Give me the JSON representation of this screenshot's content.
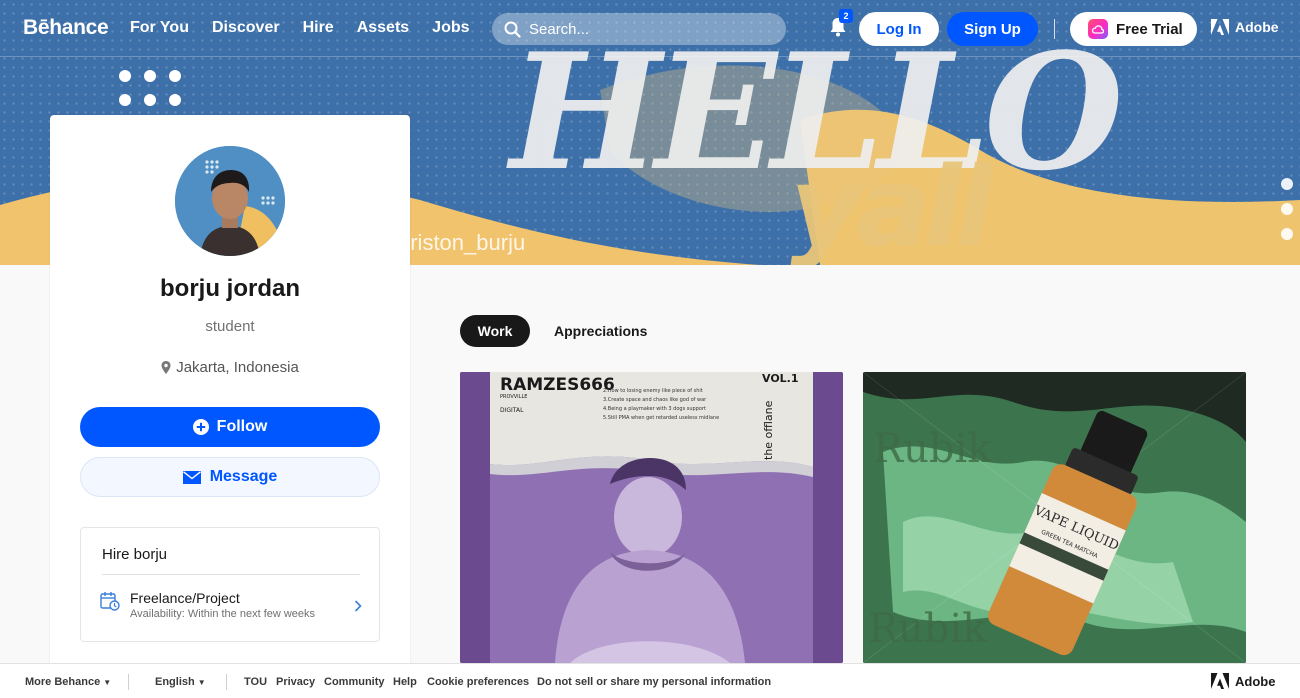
{
  "nav": {
    "logo": "Bēhance",
    "links": [
      "For You",
      "Discover",
      "Hire",
      "Assets",
      "Jobs"
    ],
    "search_placeholder": "Search...",
    "notification_count": "2",
    "login": "Log In",
    "signup": "Sign Up",
    "free_trial": "Free Trial",
    "adobe": "Adobe"
  },
  "banner": {
    "headline": "HELLO",
    "subline": "yall",
    "handle": "briston_burju"
  },
  "profile": {
    "name": "borju jordan",
    "occupation": "student",
    "location": "Jakarta, Indonesia",
    "follow_label": "Follow",
    "message_label": "Message",
    "hire": {
      "title": "Hire borju",
      "option_title": "Freelance/Project",
      "option_availability": "Availability: Within the next few weeks"
    }
  },
  "tabs": {
    "work": "Work",
    "appreciations": "Appreciations"
  },
  "projects": [
    {
      "title_art": "RAMZES666",
      "subtitle_art": "the offlane",
      "vol": "VOL.1",
      "tag1": "PROVVILLE",
      "tag2": "DIGITAL",
      "list": [
        "2.How to losing enemy like piece of shit",
        "3.Create space and chaos like god of war",
        "4.Being a playmaker with 3 dogs support",
        "5.Still PMA when get retarded useless midlane"
      ]
    },
    {
      "label_line1": "VAPE LIQUID",
      "label_line2": "GREEN TEA MATCHA",
      "brand": "Rubik"
    }
  ],
  "footer": {
    "more_behance": "More Behance",
    "language": "English",
    "links": [
      "TOU",
      "Privacy",
      "Community",
      "Help",
      "Cookie preferences",
      "Do not sell or share my personal information"
    ],
    "adobe": "Adobe"
  },
  "colors": {
    "primary": "#0057ff",
    "banner_blue": "#3d6fa8",
    "banner_yellow": "#f1c36c",
    "dark": "#191919"
  }
}
